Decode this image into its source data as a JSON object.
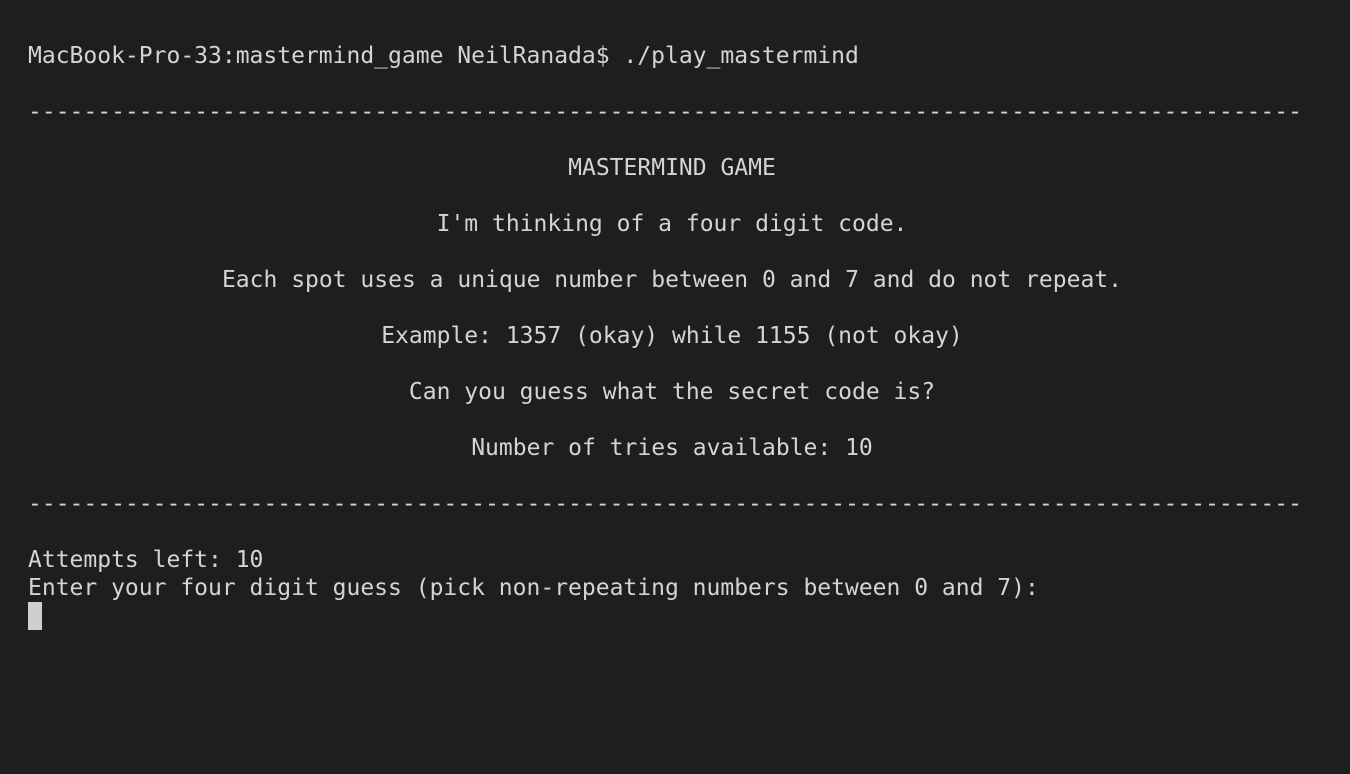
{
  "terminal": {
    "prompt": "MacBook-Pro-33:mastermind_game NeilRanada$ ./play_mastermind",
    "divider": "--------------------------------------------------------------------------------------------",
    "title": "MASTERMIND GAME",
    "intro": "I'm thinking of a four digit code.",
    "rule": "Each spot uses a unique number between 0 and 7 and do not repeat.",
    "example": "Example: 1357 (okay) while 1155 (not okay)",
    "question": "Can you guess what the secret code is?",
    "tries": "Number of tries available: 10",
    "attempts_left": "Attempts left: 10",
    "input_prompt": "Enter your four digit guess (pick non-repeating numbers between 0 and 7):"
  },
  "colors": {
    "background": "#1e1e1e",
    "text": "#d4d4d4",
    "cursor": "#cfcfcf"
  }
}
